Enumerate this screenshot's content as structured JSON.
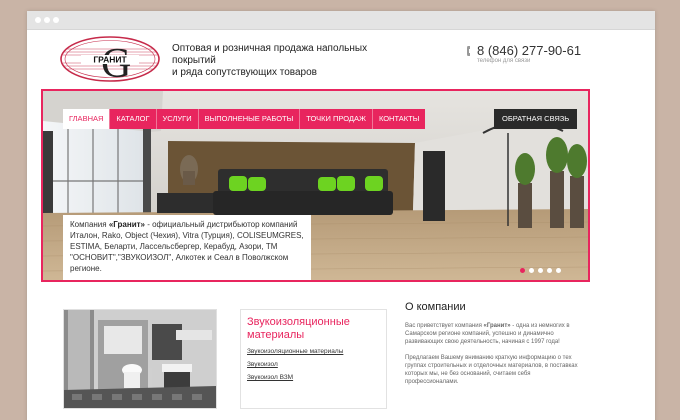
{
  "brand": {
    "logo_text": "ГРАНИТ",
    "logo_letter": "G"
  },
  "header": {
    "tagline_line1": "Оптовая и розничная продажа напольных покрытий",
    "tagline_line2": "и ряда сопутствующих товаров",
    "phone": "8 (846) 277-90-61",
    "phone_caption": "телефон для связи"
  },
  "nav": {
    "items": [
      {
        "label": "Главная",
        "active": true
      },
      {
        "label": "Каталог"
      },
      {
        "label": "Услуги"
      },
      {
        "label": "Выполненые работы"
      },
      {
        "label": "Точки продаж"
      },
      {
        "label": "Контакты"
      }
    ],
    "feedback_label": "Обратная связь"
  },
  "hero": {
    "intro_prefix": "Компания ",
    "intro_company": "«Гранит»",
    "intro_rest": " - официальный дистрибьютор компаний Италон, Rako, Object (Чехия), Vitra (Турция), COLISEUMGRES, ESTIMA, Беларти, Лассельсбергер, Керабуд, Азори, ТМ \"ОСНОВИТ\",\"ЗВУКОИЗОЛ\", Алкотек и Сеал в Поволжском регионе.",
    "slides": 5,
    "active_slide": 1
  },
  "card": {
    "title": "Звукоизоляционные материалы",
    "links": [
      "Звукоизоляционные материалы",
      "Звукоизол",
      "Звукоизол ВЗМ"
    ]
  },
  "about": {
    "title": "О компании",
    "p1_prefix": "Вас приветствует компания ",
    "p1_company": "«Гранит»",
    "p1_rest": " - одна из немногих в Самарском регионе компаний, успешно и динамично развивающих свою деятельность, начиная с 1997 года!",
    "p2": "Предлагаем Вашему вниманию краткую информацию о тех группах строительных и отделочных материалов, в поставках которых мы, не без оснований, считаем себя профессионалами."
  },
  "colors": {
    "accent": "#e8255e",
    "dark": "#2a2a2a",
    "background": "#c9b4a6"
  },
  "icons": [
    "phone-icon"
  ]
}
